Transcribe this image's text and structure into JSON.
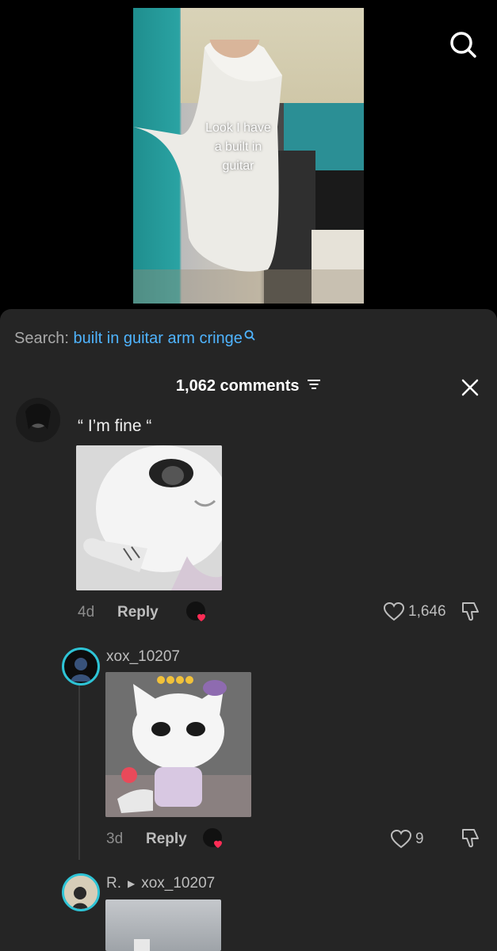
{
  "video": {
    "caption_lines": [
      "Look I have",
      "a built in",
      "guitar"
    ]
  },
  "search": {
    "prefix": "Search:",
    "query": "built in guitar arm cringe"
  },
  "comments_header": {
    "count_label": "1,062 comments"
  },
  "comments": [
    {
      "text": "“ I’m fine “",
      "age": "4d",
      "reply_label": "Reply",
      "likes": "1,646"
    },
    {
      "username": "xox_10207",
      "age": "3d",
      "reply_label": "Reply",
      "likes": "9"
    },
    {
      "username": "R.",
      "reply_to": "xox_10207"
    }
  ],
  "colors": {
    "accent": "#4fb4ff",
    "sheet": "#252525",
    "heart_red": "#fe2c55"
  }
}
